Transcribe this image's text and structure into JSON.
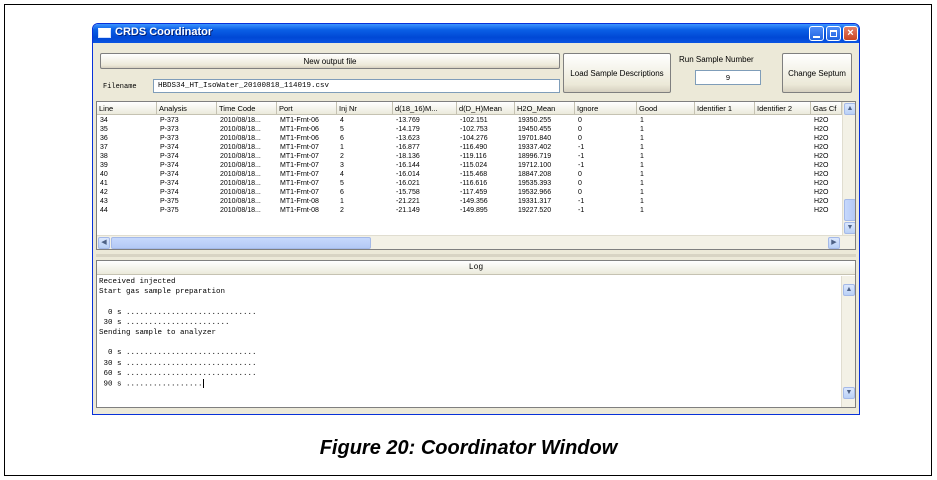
{
  "window": {
    "title": "CRDS Coordinator",
    "close_glyph": "×"
  },
  "controls": {
    "new_output_label": "New output file",
    "filename_label": "Filename",
    "filename_value": "HBDS34_HT_IsoWater_20100818_114019.csv",
    "load_descriptions_label": "Load Sample Descriptions",
    "run_sample_label": "Run Sample Number",
    "run_sample_value": "9",
    "change_septum_label": "Change Septum"
  },
  "table": {
    "columns": [
      "Line",
      "Analysis",
      "Time Code",
      "Port",
      "Inj Nr",
      "d(18_16)M...",
      "d(D_H)Mean",
      "H2O_Mean",
      "Ignore",
      "Good",
      "Identifier 1",
      "Identifier 2",
      "Gas Cf"
    ],
    "rows": [
      [
        "34",
        "P-373",
        "2010/08/18...",
        "MT1-Frnt-06",
        "4",
        "-13.769",
        "-102.151",
        "19350.255",
        "0",
        "1",
        "",
        "",
        "H2O"
      ],
      [
        "35",
        "P-373",
        "2010/08/18...",
        "MT1-Frnt-06",
        "5",
        "-14.179",
        "-102.753",
        "19450.455",
        "0",
        "1",
        "",
        "",
        "H2O"
      ],
      [
        "36",
        "P-373",
        "2010/08/18...",
        "MT1-Frnt-06",
        "6",
        "-13.623",
        "-104.276",
        "19701.840",
        "0",
        "1",
        "",
        "",
        "H2O"
      ],
      [
        "37",
        "P-374",
        "2010/08/18...",
        "MT1-Frnt-07",
        "1",
        "-16.877",
        "-116.490",
        "19337.402",
        "-1",
        "1",
        "",
        "",
        "H2O"
      ],
      [
        "38",
        "P-374",
        "2010/08/18...",
        "MT1-Frnt-07",
        "2",
        "-18.136",
        "-119.116",
        "18996.719",
        "-1",
        "1",
        "",
        "",
        "H2O"
      ],
      [
        "39",
        "P-374",
        "2010/08/18...",
        "MT1-Frnt-07",
        "3",
        "-16.144",
        "-115.024",
        "19712.100",
        "-1",
        "1",
        "",
        "",
        "H2O"
      ],
      [
        "40",
        "P-374",
        "2010/08/18...",
        "MT1-Frnt-07",
        "4",
        "-16.014",
        "-115.468",
        "18847.208",
        "0",
        "1",
        "",
        "",
        "H2O"
      ],
      [
        "41",
        "P-374",
        "2010/08/18...",
        "MT1-Frnt-07",
        "5",
        "-16.021",
        "-116.616",
        "19535.393",
        "0",
        "1",
        "",
        "",
        "H2O"
      ],
      [
        "42",
        "P-374",
        "2010/08/18...",
        "MT1-Frnt-07",
        "6",
        "-15.758",
        "-117.459",
        "19532.966",
        "0",
        "1",
        "",
        "",
        "H2O"
      ],
      [
        "43",
        "P-375",
        "2010/08/18...",
        "MT1-Frnt-08",
        "1",
        "-21.221",
        "-149.356",
        "19331.317",
        "-1",
        "1",
        "",
        "",
        "H2O"
      ],
      [
        "44",
        "P-375",
        "2010/08/18...",
        "MT1-Frnt-08",
        "2",
        "-21.149",
        "-149.895",
        "19227.520",
        "-1",
        "1",
        "",
        "",
        "H2O"
      ]
    ],
    "scroll_up_glyph": "▲",
    "scroll_down_glyph": "▼",
    "scroll_left_glyph": "◀",
    "scroll_right_glyph": "▶"
  },
  "log": {
    "title": "Log",
    "lines": [
      "Received injected",
      "Start gas sample preparation",
      "",
      "  0 s .............................",
      " 30 s .......................",
      "Sending sample to analyzer",
      "",
      "  0 s .............................",
      " 30 s .............................",
      " 60 s .............................",
      " 90 s ................."
    ]
  },
  "caption": "Figure 20: Coordinator Window"
}
